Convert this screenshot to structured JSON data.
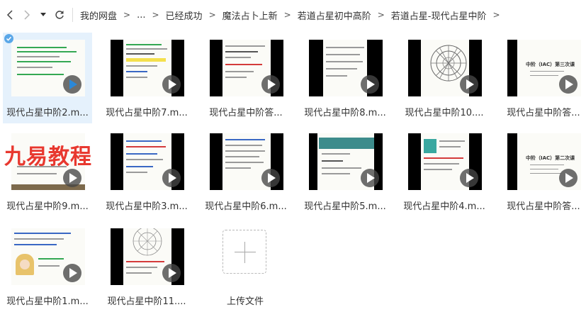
{
  "nav": {
    "back_icon": "chevron-left-icon",
    "forward_icon": "chevron-right-icon",
    "history_icon": "caret-down-icon",
    "refresh_icon": "refresh-icon"
  },
  "breadcrumb": {
    "items": [
      "我的网盘",
      "...",
      "已经成功",
      "魔法占卜上新",
      "若道占星初中高阶",
      "若道占星-现代占星中阶"
    ],
    "separator": ">"
  },
  "watermark": "九易教程",
  "files": [
    {
      "name": "现代占星中阶2.m...",
      "selected": true
    },
    {
      "name": "现代占星中阶7.m..."
    },
    {
      "name": "现代占星中阶答..."
    },
    {
      "name": "现代占星中阶8.m..."
    },
    {
      "name": "现代占星中阶10...."
    },
    {
      "name": "现代占星中阶答..."
    },
    {
      "name": "现代占星中阶9.m..."
    },
    {
      "name": "现代占星中阶3.m..."
    },
    {
      "name": "现代占星中阶6.m..."
    },
    {
      "name": "现代占星中阶5.m..."
    },
    {
      "name": "现代占星中阶4.m..."
    },
    {
      "name": "现代占星中阶答..."
    },
    {
      "name": "现代占星中阶1.m..."
    },
    {
      "name": "现代占星中阶11...."
    }
  ],
  "thumb_text": {
    "slide_title_1": "中阶（IAC）第三次课",
    "slide_title_2": "中阶（IAC）第二次课"
  },
  "upload": {
    "label": "上传文件"
  },
  "colors": {
    "selected_bg": "#e5f1fc",
    "check": "#5aa7e8",
    "watermark": "#e8382f",
    "play_accent": "#2b88d8"
  }
}
